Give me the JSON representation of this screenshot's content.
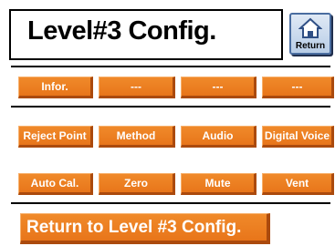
{
  "header": {
    "title": "Level#3 Config."
  },
  "return_icon": {
    "label": "Return",
    "icon": "home-return-icon"
  },
  "rows": [
    [
      "Infor.",
      "---",
      "---",
      "---"
    ],
    [
      "Reject Point",
      "Method",
      "Audio",
      "Digital Voice"
    ],
    [
      "Auto Cal.",
      "Zero",
      "Mute",
      "Vent"
    ]
  ],
  "footer": {
    "return_label": "Return to Level #3 Config."
  },
  "colors": {
    "button": "#e8751a",
    "button_shadow": "#ab4a0d",
    "icon_accent": "#4a6da0"
  }
}
